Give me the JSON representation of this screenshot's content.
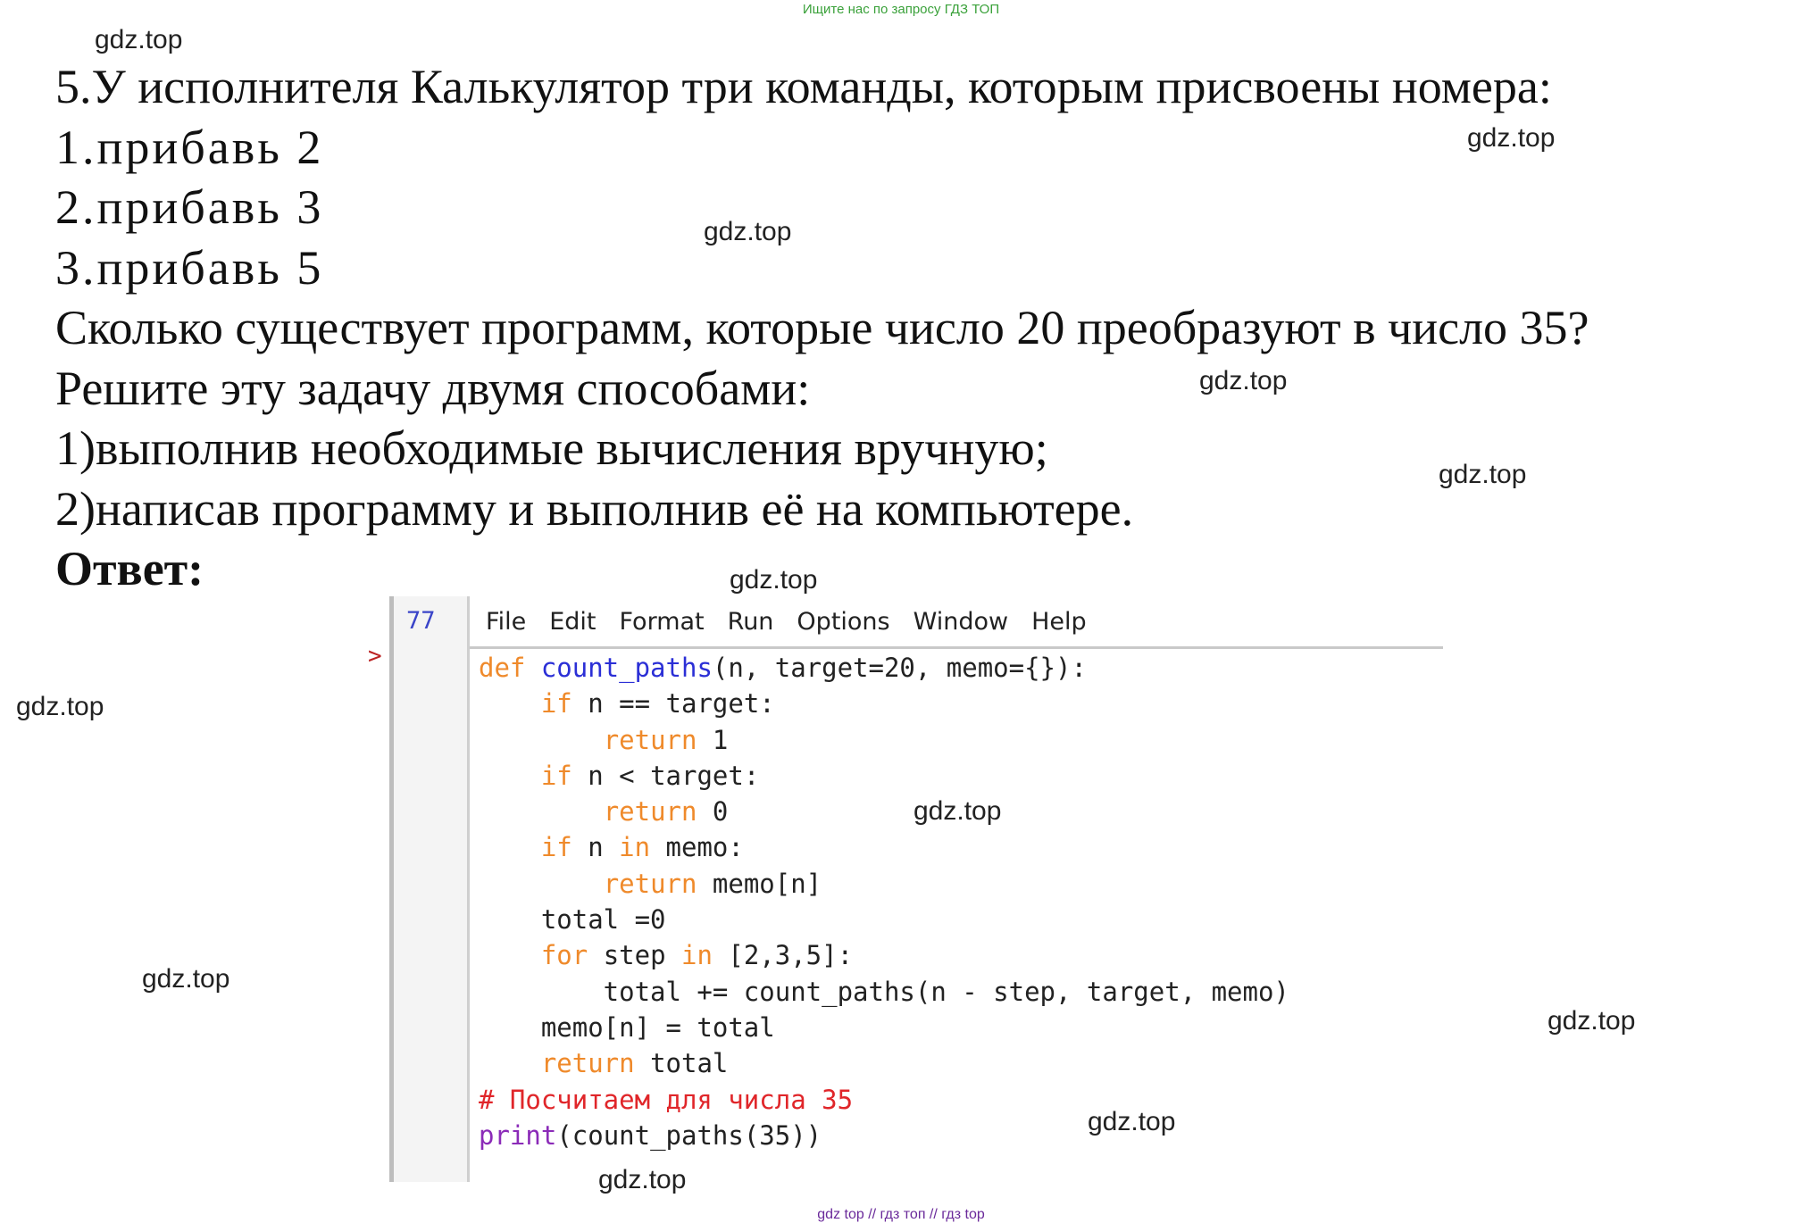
{
  "banner_top": "Ищите нас по запросу ГДЗ ТОП",
  "problem": {
    "lines": [
      "5.У исполнителя Калькулятор три команды, которым присвоены номера:",
      "1.прибавь 2",
      "2.прибавь 3",
      "3.прибавь 5",
      "Сколько существует программ, которые число 20 преобразуют в число 35?",
      "Решите эту задачу двумя способами:",
      "1)выполнив необходимые вычисления вручную;",
      "2)написав программу и выполнив её на компьютере."
    ],
    "answer_label": "Ответ:"
  },
  "watermark": "gdz.top",
  "editor": {
    "line_number": "77",
    "menu": [
      "File",
      "Edit",
      "Format",
      "Run",
      "Options",
      "Window",
      "Help"
    ],
    "code": [
      [
        [
          "kw",
          "def "
        ],
        [
          "fn",
          "count_paths"
        ],
        [
          "",
          "(n, target=20, memo={}):"
        ]
      ],
      [
        [
          "",
          "    "
        ],
        [
          "kw",
          "if"
        ],
        [
          "",
          " n == target:"
        ]
      ],
      [
        [
          "",
          "        "
        ],
        [
          "kw",
          "return"
        ],
        [
          "",
          " 1"
        ]
      ],
      [
        [
          "",
          "    "
        ],
        [
          "kw",
          "if"
        ],
        [
          "",
          " n < target:"
        ]
      ],
      [
        [
          "",
          "        "
        ],
        [
          "kw",
          "return"
        ],
        [
          "",
          " 0"
        ]
      ],
      [
        [
          "",
          "    "
        ],
        [
          "kw",
          "if"
        ],
        [
          "",
          " n "
        ],
        [
          "kw",
          "in"
        ],
        [
          "",
          " memo:"
        ]
      ],
      [
        [
          "",
          "        "
        ],
        [
          "kw",
          "return"
        ],
        [
          "",
          " memo[n]"
        ]
      ],
      [
        [
          "",
          "    total =0"
        ]
      ],
      [
        [
          "",
          "    "
        ],
        [
          "kw",
          "for"
        ],
        [
          "",
          " step "
        ],
        [
          "kw",
          "in"
        ],
        [
          "",
          " [2,3,5]:"
        ]
      ],
      [
        [
          "",
          "        total += count_paths(n - step, target, memo)"
        ]
      ],
      [
        [
          "",
          "    memo[n] = total"
        ]
      ],
      [
        [
          "",
          "    "
        ],
        [
          "kw",
          "return"
        ],
        [
          "",
          " total"
        ]
      ],
      [
        [
          "cm",
          "# Посчитаем для числа 35"
        ]
      ],
      [
        [
          "bi",
          "print"
        ],
        [
          "",
          "(count_paths(35))"
        ]
      ]
    ]
  },
  "banner_bottom": "gdz top // гдз топ // гдз top"
}
